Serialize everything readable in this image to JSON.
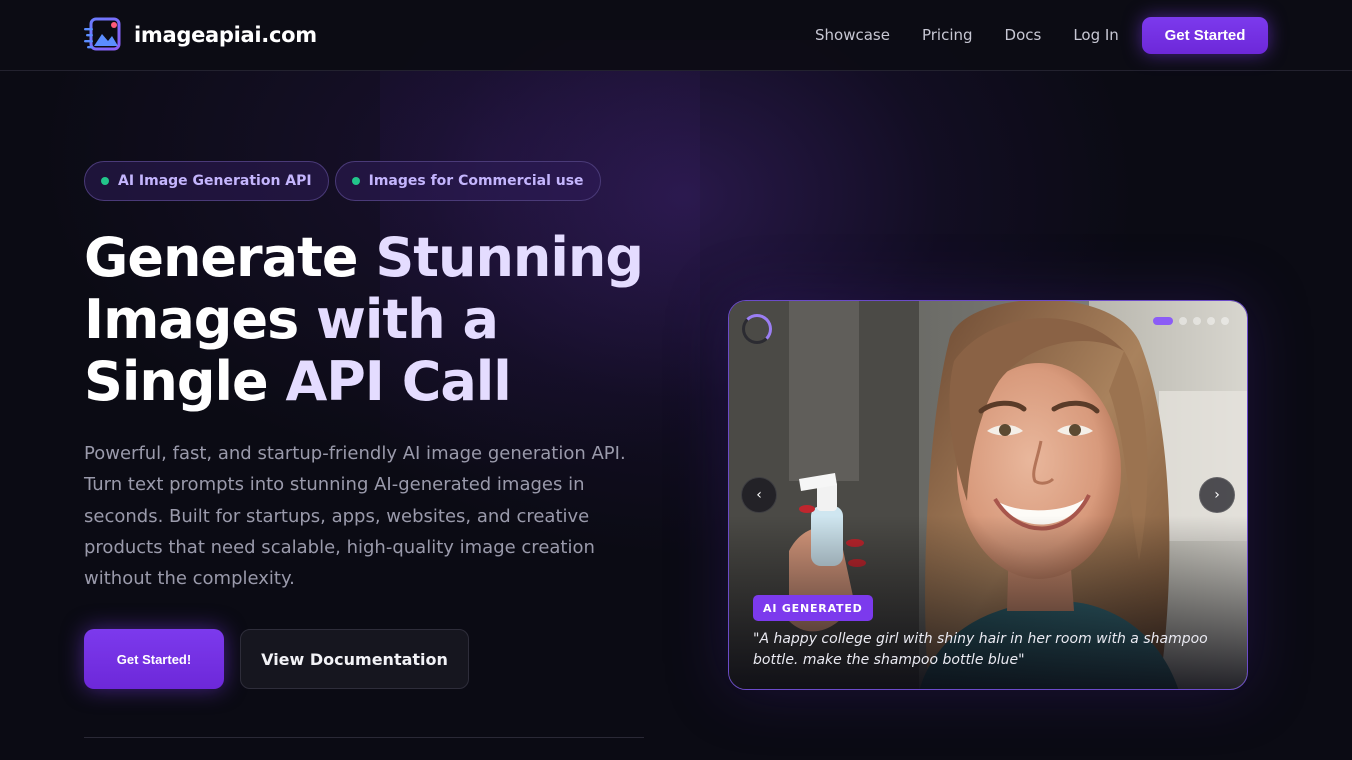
{
  "nav": {
    "brand": "imageapiai.com",
    "links": [
      "Showcase",
      "Pricing",
      "Docs",
      "Log In"
    ],
    "cta": "Get Started"
  },
  "hero": {
    "badges": [
      "AI Image Generation API",
      "Images for Commercial use"
    ],
    "headline": {
      "line1_a": "Generate ",
      "line1_b": "Stunning",
      "line2_a": "Images ",
      "line2_b": "with a",
      "line3_a": "Single ",
      "line3_b": "API Call"
    },
    "subtext": "Powerful, fast, and startup-friendly AI image generation API. Turn text prompts into stunning AI-generated images in seconds. Built for startups, apps, websites, and creative products that need scalable, high-quality image creation without the complexity.",
    "primary_cta": "Get Started!",
    "secondary_cta": "View Documentation"
  },
  "carousel": {
    "badge": "AI GENERATED",
    "caption": "\"A happy college girl with shiny hair in her room with a shampoo bottle. make the shampoo bottle blue\"",
    "prev": "‹",
    "next": "›",
    "slide_count": 5,
    "active_slide": 1
  },
  "colors": {
    "accent": "#7c3aed",
    "background": "#0b0b14",
    "badge_dot": "#22c58a"
  }
}
